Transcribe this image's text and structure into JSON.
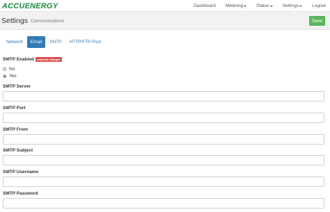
{
  "brand": {
    "logo_text": "ACCUENERGY",
    "color": "#1a8c3c"
  },
  "nav": {
    "items": [
      {
        "label": "Dashboard",
        "dropdown": false
      },
      {
        "label": "Metering",
        "dropdown": true
      },
      {
        "label": "Status",
        "dropdown": true
      },
      {
        "label": "Settings",
        "dropdown": true
      },
      {
        "label": "Logout",
        "dropdown": false
      }
    ]
  },
  "header": {
    "title": "Settings",
    "subtitle": "Communications",
    "save_label": "Save"
  },
  "tabs": [
    {
      "label": "Network",
      "active": false
    },
    {
      "label": "Email",
      "active": true
    },
    {
      "label": "SNTP",
      "active": false
    },
    {
      "label": "HTTP/FTP Post",
      "active": false
    }
  ],
  "smtp_enabled": {
    "label": "SMTP Enabled",
    "badge": "unsaved changes",
    "options": [
      {
        "label": "No",
        "checked": false
      },
      {
        "label": "Yes",
        "checked": true
      }
    ]
  },
  "fields": {
    "server": {
      "label": "SMTP Server",
      "value": ""
    },
    "port": {
      "label": "SMTP Port",
      "value": ""
    },
    "from": {
      "label": "SMTP From",
      "value": ""
    },
    "subject": {
      "label": "SMTP Subject",
      "value": ""
    },
    "username": {
      "label": "SMTP Username",
      "value": ""
    },
    "password": {
      "label": "SMTP Password",
      "value": ""
    }
  },
  "colors": {
    "accent": "#337ab7",
    "success": "#5cb85c",
    "danger": "#d9534f"
  }
}
